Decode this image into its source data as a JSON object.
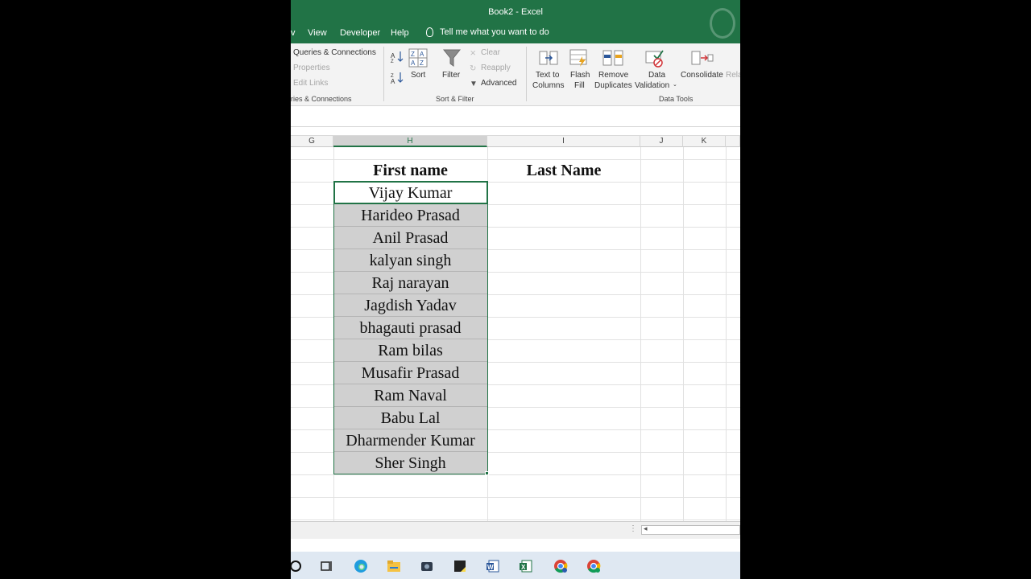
{
  "window": {
    "title": "Book2  -  Excel"
  },
  "menu": {
    "partial_first": "v",
    "items": [
      "View",
      "Developer",
      "Help"
    ],
    "tell_me": "Tell me what you want to do"
  },
  "ribbon": {
    "queries": {
      "items": [
        "Queries & Connections",
        "Properties",
        "Edit Links"
      ],
      "group_label": "ries & Connections"
    },
    "sort_filter": {
      "sort_label": "Sort",
      "filter_label": "Filter",
      "clear_label": "Clear",
      "reapply_label": "Reapply",
      "advanced_label": "Advanced",
      "group_label": "Sort & Filter"
    },
    "data_tools": {
      "text_to_columns": [
        "Text to",
        "Columns"
      ],
      "flash_fill": [
        "Flash",
        "Fill"
      ],
      "remove_duplicates": [
        "Remove",
        "Duplicates"
      ],
      "data_validation": [
        "Data",
        "Validation"
      ],
      "consolidate_label": "Consolidate",
      "relationships_partial": "Rela",
      "group_label": "Data Tools"
    }
  },
  "grid": {
    "columns": [
      "G",
      "H",
      "I",
      "J",
      "K"
    ],
    "selected_column": "H",
    "header_first": "First name",
    "header_last": "Last Name",
    "first_names": [
      "Vijay Kumar",
      "Harideo Prasad",
      "Anil Prasad",
      "kalyan singh",
      "Raj narayan",
      "Jagdish Yadav",
      "bhagauti prasad",
      "Ram bilas",
      "Musafir Prasad",
      "Ram Naval",
      "Babu Lal",
      "Dharmender Kumar",
      "Sher Singh"
    ]
  },
  "taskbar": {
    "apps": [
      "cortana-icon",
      "task-view-icon",
      "edge-icon",
      "file-explorer-icon",
      "media-icon",
      "sticky-notes-icon",
      "word-icon",
      "excel-icon",
      "chrome-icon",
      "chrome-profile-icon"
    ]
  },
  "colors": {
    "excel_green": "#217346",
    "selection_fill": "#d0d0d0"
  }
}
